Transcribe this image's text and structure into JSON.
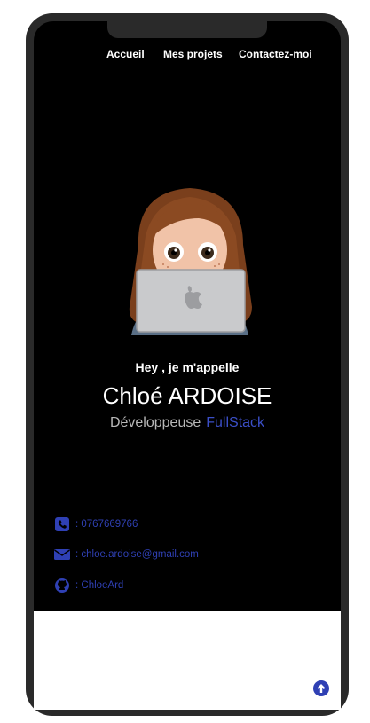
{
  "nav": {
    "items": [
      {
        "label": "Accueil"
      },
      {
        "label": "Mes projets"
      },
      {
        "label": "Contactez-moi"
      }
    ]
  },
  "hero": {
    "greeting": "Hey , je m'appelle",
    "name": "Chloé ARDOISE",
    "role_main": "Développeuse",
    "role_accent": "FullStack"
  },
  "contacts": {
    "phone": ": 0767669766",
    "email": ": chloe.ardoise@gmail.com",
    "github": ": ChloeArd"
  },
  "colors": {
    "accent": "#3b4fc8",
    "contact_text": "#2f40b4",
    "background": "#000000"
  },
  "icons": {
    "phone": "phone-icon",
    "email": "envelope-icon",
    "github": "github-icon",
    "scroll_top": "arrow-up-circle-icon"
  }
}
